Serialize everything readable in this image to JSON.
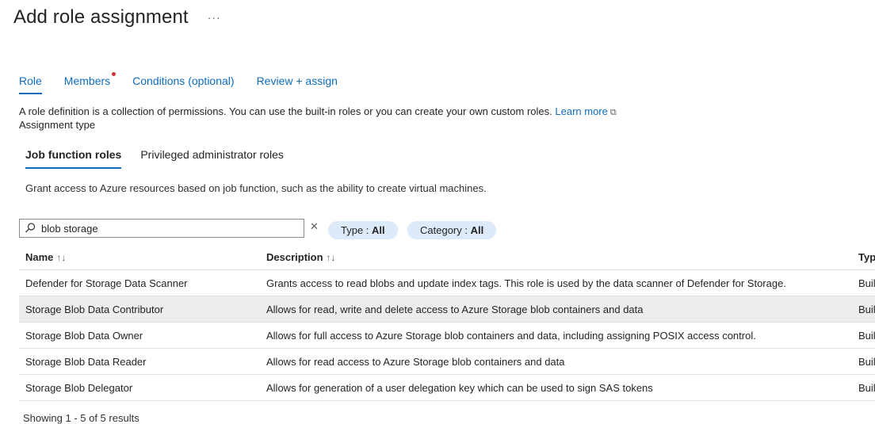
{
  "page": {
    "title": "Add role assignment",
    "more": "···"
  },
  "tabs": [
    {
      "label": "Role"
    },
    {
      "label": "Members"
    },
    {
      "label": "Conditions (optional)"
    },
    {
      "label": "Review + assign"
    }
  ],
  "description": {
    "text": "A role definition is a collection of permissions. You can use the built-in roles or you can create your own custom roles.",
    "link": "Learn more"
  },
  "assignment_type_label": "Assignment type",
  "subtabs": [
    {
      "label": "Job function roles"
    },
    {
      "label": "Privileged administrator roles"
    }
  ],
  "grant_text": "Grant access to Azure resources based on job function, such as the ability to create virtual machines.",
  "search": {
    "value": "blob storage"
  },
  "filters": {
    "type_label": "Type : ",
    "type_value": "All",
    "category_label": "Category : ",
    "category_value": "All"
  },
  "table": {
    "headers": [
      "Name",
      "Description",
      "Typ"
    ],
    "rows": [
      {
        "name": "Defender for Storage Data Scanner",
        "description": "Grants access to read blobs and update index tags. This role is used by the data scanner of Defender for Storage.",
        "type": "Buil"
      },
      {
        "name": "Storage Blob Data Contributor",
        "description": "Allows for read, write and delete access to Azure Storage blob containers and data",
        "type": "Buil"
      },
      {
        "name": "Storage Blob Data Owner",
        "description": "Allows for full access to Azure Storage blob containers and data, including assigning POSIX access control.",
        "type": "Buil"
      },
      {
        "name": "Storage Blob Data Reader",
        "description": "Allows for read access to Azure Storage blob containers and data",
        "type": "Buil"
      },
      {
        "name": "Storage Blob Delegator",
        "description": "Allows for generation of a user delegation key which can be used to sign SAS tokens",
        "type": "Buil"
      }
    ]
  },
  "results_text": "Showing 1 - 5 of 5 results",
  "colors": {
    "accent": "#0f6cbd",
    "pill": "#ddeafa",
    "selected_row": "#ededed",
    "dot": "#d13438"
  }
}
